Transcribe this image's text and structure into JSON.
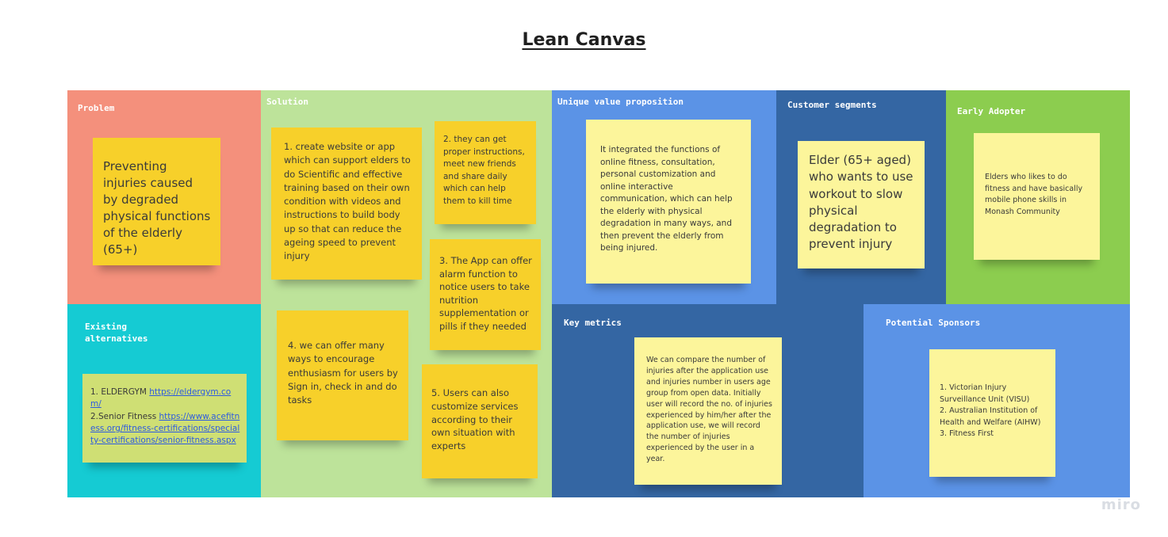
{
  "board": {
    "title": "Lean Canvas",
    "brand": "miro"
  },
  "sections": {
    "problem": {
      "label": "Problem",
      "color": "#f4907c"
    },
    "solution": {
      "label": "Solution",
      "color": "#bde39a"
    },
    "uvp": {
      "label": "Unique value proposition",
      "color": "#5b93e6"
    },
    "customer": {
      "label": "Customer segments",
      "color": "#3466a3"
    },
    "early": {
      "label": "Early Adopter",
      "color": "#8ccd4f"
    },
    "existing": {
      "label": "Existing\nalternatives",
      "color": "#15cbd3"
    },
    "metrics": {
      "label": "Key metrics",
      "color": "#3466a3"
    },
    "sponsors": {
      "label": "Potential Sponsors",
      "color": "#5b93e6"
    }
  },
  "notes": {
    "problem": "Preventing injuries caused by degraded physical functions of the elderly (65+)",
    "solution1": "1. create website or app which can support elders to do Scientific and effective training based on their own condition with videos and instructions  to build body up so that can reduce the ageing speed to prevent injury",
    "solution2": "2. they can get proper instructions, meet new friends and share daily which can help them to kill time",
    "solution3": "3. The App can offer alarm function to notice users to take nutrition supplementation or pills if they needed",
    "solution4": "4. we can offer many ways to encourage enthusiasm for users by Sign in, check in and do tasks",
    "solution5": "5. Users can also customize services according to their own situation with experts",
    "uvp": "It integrated the functions of online fitness, consultation, personal customization and online interactive communication, which can help the elderly with physical degradation in many ways, and then prevent the elderly from being injured.",
    "customer": "Elder (65+ aged) who wants to use workout to slow physical degradation to prevent injury",
    "early": "Elders who likes to do fitness and have basically mobile phone skills in Monash Community",
    "existing": {
      "line1_prefix": "1. ELDERGYM ",
      "link1": "https://eldergym.com/",
      "line2_prefix": "2.Senior Fitness ",
      "link2": "https://www.acefitness.org/fitness-certifications/specialty-certifications/senior-fitness.aspx"
    },
    "metrics": "We can compare the number of injuries after the application use and injuries number in users age group from open data. Initially user will record the no. of injuries experienced by him/her after the application use, we will record the number of injuries experienced by the user in a year.",
    "sponsors": [
      "1. Victorian Injury Surveillance Unit (VISU)",
      "2. Australian Institution of Health and Welfare (AIHW)",
      "3. Fitness First"
    ]
  }
}
